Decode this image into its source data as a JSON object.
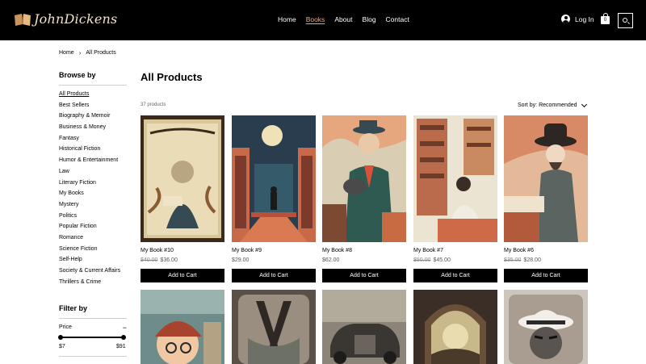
{
  "header": {
    "logo_text": "JohnDickens",
    "nav": [
      "Home",
      "Books",
      "About",
      "Blog",
      "Contact"
    ],
    "active_nav": "Books",
    "login_label": "Log In",
    "cart_count": "0",
    "accent": "#e0a88a"
  },
  "breadcrumb": {
    "home": "Home",
    "current": "All Products"
  },
  "sidebar": {
    "browse_title": "Browse by",
    "categories": [
      "All Products",
      "Best Sellers",
      "Biography & Memoir",
      "Business & Money",
      "Fantasy",
      "Historical Fiction",
      "Humor & Entertainment",
      "Law",
      "Literary Fiction",
      "My Books",
      "Mystery",
      "Politics",
      "Popular Fiction",
      "Romance",
      "Science Fiction",
      "Self-Help",
      "Society & Current Affairs",
      "Thrillers & Crime"
    ],
    "active_category": "All Products",
    "filter_title": "Filter by",
    "price_label": "Price",
    "price_toggle": "−",
    "price_min": "$7",
    "price_max": "$91"
  },
  "main": {
    "title": "All Products",
    "count": "37 products",
    "sort_label": "Sort by: Recommended",
    "add_to_cart": "Add to Cart",
    "products": [
      {
        "name": "My Book #10",
        "old_price": "$40.00",
        "price": "$36.00"
      },
      {
        "name": "My Book #9",
        "old_price": "",
        "price": "$29.00"
      },
      {
        "name": "My Book #8",
        "old_price": "",
        "price": "$62.00"
      },
      {
        "name": "My Book #7",
        "old_price": "$50.00",
        "price": "$45.00"
      },
      {
        "name": "My Book #6",
        "old_price": "$35.00",
        "price": "$28.00"
      }
    ]
  }
}
